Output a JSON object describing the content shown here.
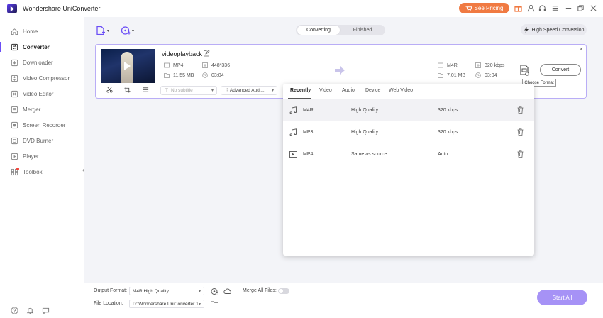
{
  "titlebar": {
    "app_name": "Wondershare UniConverter",
    "pricing_label": "See Pricing"
  },
  "sidebar": {
    "items": [
      {
        "label": "Home",
        "icon": "home-icon"
      },
      {
        "label": "Converter",
        "icon": "converter-icon",
        "active": true
      },
      {
        "label": "Downloader",
        "icon": "download-icon"
      },
      {
        "label": "Video Compressor",
        "icon": "compress-icon"
      },
      {
        "label": "Video Editor",
        "icon": "scissors-icon"
      },
      {
        "label": "Merger",
        "icon": "merge-icon"
      },
      {
        "label": "Screen Recorder",
        "icon": "record-icon"
      },
      {
        "label": "DVD Burner",
        "icon": "disc-icon"
      },
      {
        "label": "Player",
        "icon": "play-icon"
      },
      {
        "label": "Toolbox",
        "icon": "grid-icon"
      }
    ]
  },
  "toolbar": {
    "tabs": [
      "Converting",
      "Finished"
    ],
    "active_tab": "Converting",
    "high_speed_label": "High Speed Conversion"
  },
  "file": {
    "name": "videoplayback",
    "source": {
      "format": "MP4",
      "resolution": "448*336",
      "size": "11.55 MB",
      "duration": "03:04"
    },
    "target": {
      "format": "M4R",
      "bitrate": "320 kbps",
      "size": "7.01 MB",
      "duration": "03:04"
    },
    "subtitle_placeholder": "No subtitle",
    "audio_label": "Advanced Audi...",
    "choose_format_tooltip": "Choose Format",
    "convert_label": "Convert"
  },
  "format_panel": {
    "tabs": [
      "Recently",
      "Video",
      "Audio",
      "Device",
      "Web Video"
    ],
    "active_tab": "Recently",
    "rows": [
      {
        "format": "M4R",
        "quality": "High Quality",
        "bitrate": "320 kbps",
        "icon": "music-note-icon",
        "selected": true
      },
      {
        "format": "MP3",
        "quality": "High Quality",
        "bitrate": "320 kbps",
        "icon": "music-note-icon",
        "selected": false
      },
      {
        "format": "MP4",
        "quality": "Same as source",
        "bitrate": "Auto",
        "icon": "video-file-icon",
        "selected": false
      }
    ]
  },
  "bottom": {
    "output_format_label": "Output Format:",
    "output_format_value": "M4R High Quality",
    "merge_label": "Merge All Files:",
    "file_location_label": "File Location:",
    "file_location_value": "D:\\Wondershare UniConverter 1",
    "start_all_label": "Start All"
  },
  "colors": {
    "accent": "#6b4ef6",
    "pricing": "#f07a42",
    "start_all": "#a692f6"
  }
}
